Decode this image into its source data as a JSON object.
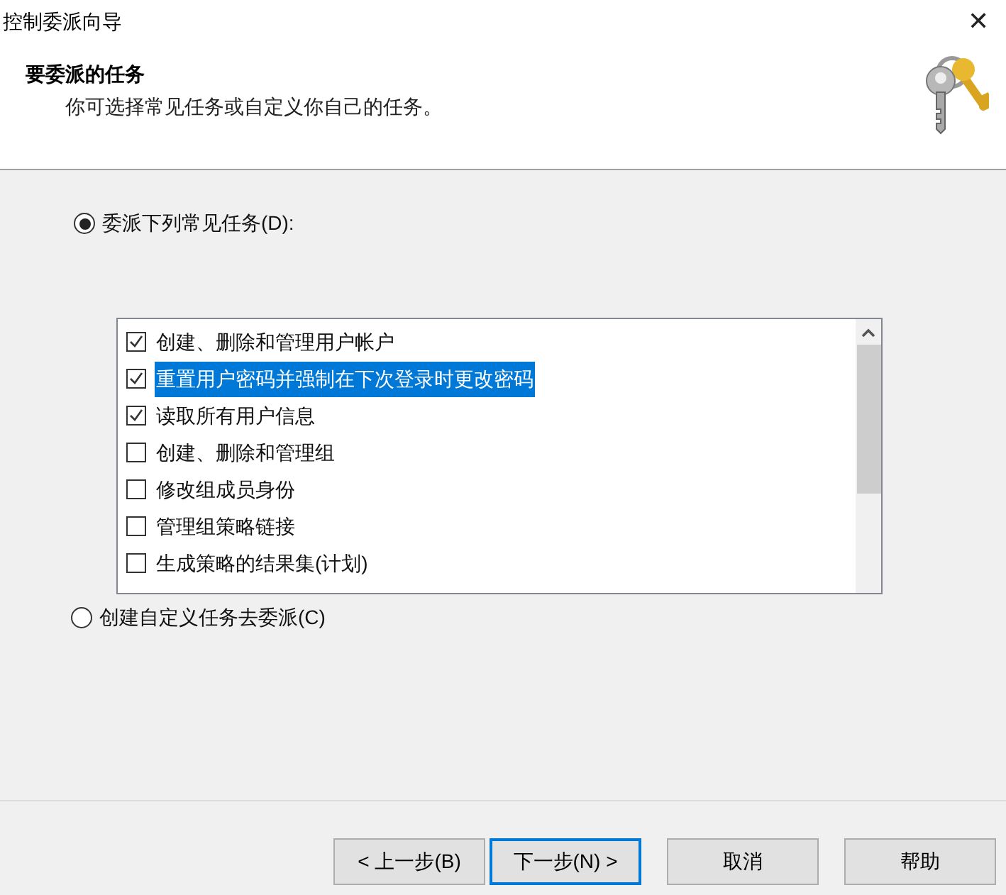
{
  "window": {
    "title": "控制委派向导",
    "close": "✕"
  },
  "header": {
    "title": "要委派的任务",
    "subtitle": "你可选择常见任务或自定义你自己的任务。"
  },
  "options": [
    {
      "label": "委派下列常见任务(D):",
      "selected": true
    },
    {
      "label": "创建自定义任务去委派(C)",
      "selected": false
    }
  ],
  "tasks": [
    {
      "label": "创建、删除和管理用户帐户",
      "checked": true,
      "selected": false
    },
    {
      "label": "重置用户密码并强制在下次登录时更改密码",
      "checked": true,
      "selected": true
    },
    {
      "label": "读取所有用户信息",
      "checked": true,
      "selected": false
    },
    {
      "label": "创建、删除和管理组",
      "checked": false,
      "selected": false
    },
    {
      "label": "修改组成员身份",
      "checked": false,
      "selected": false
    },
    {
      "label": "管理组策略链接",
      "checked": false,
      "selected": false
    },
    {
      "label": "生成策略的结果集(计划)",
      "checked": false,
      "selected": false
    }
  ],
  "buttons": [
    {
      "label": "< 上一步(B)",
      "focused": false
    },
    {
      "label": "下一步(N) >",
      "focused": true
    },
    {
      "label": "取消",
      "focused": false
    },
    {
      "label": "帮助",
      "focused": false
    }
  ]
}
